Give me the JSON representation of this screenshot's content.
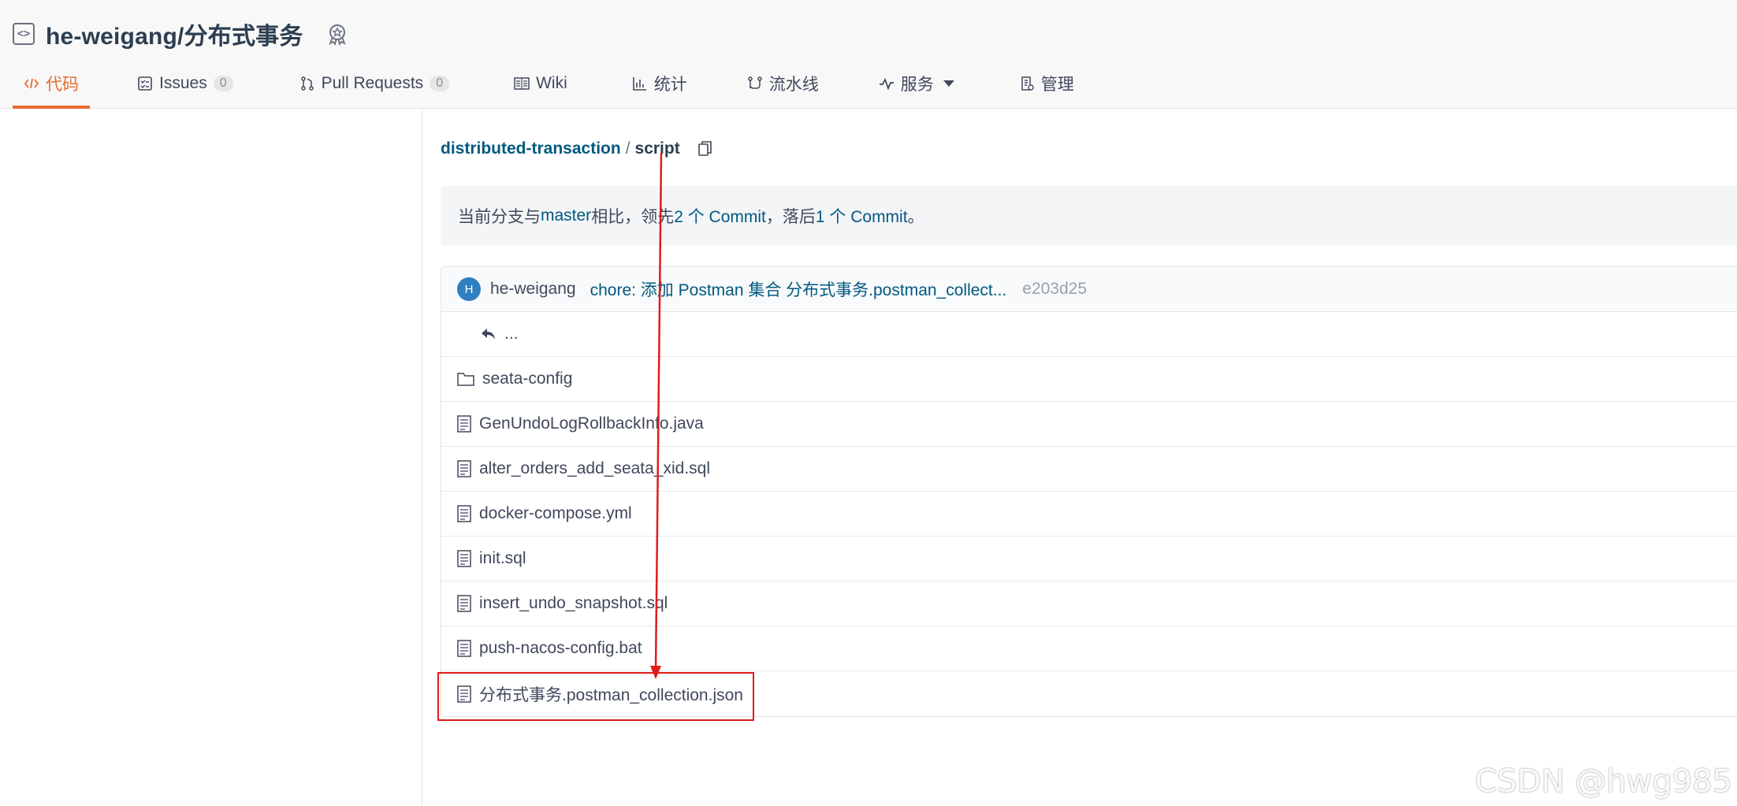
{
  "repo": {
    "title": "he-weigang/分布式事务"
  },
  "tabs": [
    {
      "label": "代码",
      "icon": "code-icon",
      "active": true
    },
    {
      "label": "Issues",
      "count": "0",
      "icon": "issues-icon"
    },
    {
      "label": "Pull Requests",
      "count": "0",
      "icon": "pull-request-icon"
    },
    {
      "label": "Wiki",
      "icon": "wiki-icon"
    },
    {
      "label": "统计",
      "icon": "stats-icon"
    },
    {
      "label": "流水线",
      "icon": "pipeline-icon"
    },
    {
      "label": "服务",
      "icon": "service-icon"
    },
    {
      "label": "管理",
      "icon": "manage-icon"
    }
  ],
  "breadcrumb": {
    "root": "distributed-transaction",
    "separator": "/",
    "current": "script"
  },
  "compare": {
    "prefix": "当前分支与 ",
    "branch": "master",
    "mid1": " 相比，领先 ",
    "ahead": "2 个 Commit",
    "mid2": "，落后 ",
    "behind": "1 个 Commit",
    "suffix": "。"
  },
  "commit": {
    "avatar_letter": "H",
    "author": "he-weigang",
    "message": "chore: 添加 Postman 集合 分布式事务.postman_collect...",
    "sha": "e203d25"
  },
  "files": {
    "up": "...",
    "items": [
      {
        "name": "seata-config",
        "type": "folder"
      },
      {
        "name": "GenUndoLogRollbackInfo.java",
        "type": "file"
      },
      {
        "name": "alter_orders_add_seata_xid.sql",
        "type": "file"
      },
      {
        "name": "docker-compose.yml",
        "type": "file"
      },
      {
        "name": "init.sql",
        "type": "file"
      },
      {
        "name": "insert_undo_snapshot.sql",
        "type": "file"
      },
      {
        "name": "push-nacos-config.bat",
        "type": "file"
      },
      {
        "name": "分布式事务.postman_collection.json",
        "type": "file"
      }
    ]
  },
  "watermark": "CSDN @hwg985",
  "colors": {
    "accent": "#e86a2c",
    "link": "#005980",
    "annotation": "#e01b1b"
  }
}
